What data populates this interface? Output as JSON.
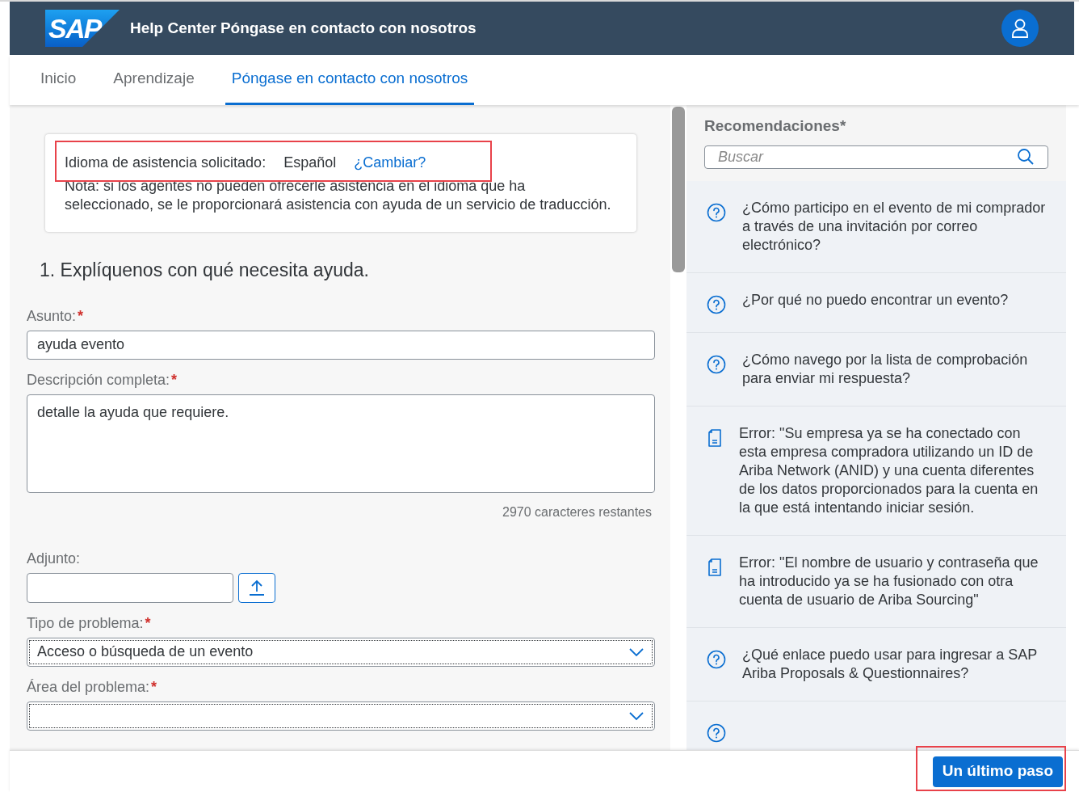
{
  "header": {
    "logo": "SAP",
    "title": "Help Center Póngase en contacto con nosotros"
  },
  "tabs": [
    {
      "label": "Inicio",
      "selected": false
    },
    {
      "label": "Aprendizaje",
      "selected": false
    },
    {
      "label": "Póngase en contacto con nosotros",
      "selected": true
    }
  ],
  "language_notice": {
    "label": "Idioma de asistencia solicitado:",
    "value": "Español",
    "link": "¿Cambiar?",
    "highlighted": true,
    "note": "Nota: si los agentes no pueden ofrecerle asistencia en el idioma que ha seleccionado, se le proporcionará asistencia con ayuda de un servicio de traducción."
  },
  "section_title": "1. Explíquenos con qué necesita ayuda.",
  "form": [
    {
      "kind": "text",
      "label": "Asunto:",
      "required_mark": "*",
      "value": "ayuda evento"
    },
    {
      "kind": "textarea",
      "label": "Descripción completa:",
      "required_mark": "*",
      "value": "detalle la ayuda que requiere.",
      "counter": "2970 caracteres restantes"
    },
    {
      "kind": "file",
      "label": "Adjunto:"
    },
    {
      "kind": "select",
      "label": "Tipo de problema:",
      "required_mark": "*",
      "value": "Acceso o búsqueda de un evento"
    },
    {
      "kind": "select",
      "label": "Área del problema:",
      "required_mark": "*"
    }
  ],
  "recommendations": {
    "title": "Recomendaciones*",
    "search_placeholder": "Buscar",
    "items": [
      {
        "kind": "question",
        "text": "¿Cómo participo en el evento de mi comprador a través de una invitación por correo electrónico?"
      },
      {
        "kind": "question",
        "text": "¿Por qué no puedo encontrar un evento?"
      },
      {
        "kind": "question",
        "text": "¿Cómo navego por la lista de comprobación para enviar mi respuesta?"
      },
      {
        "kind": "document",
        "text": "Error: \"Su empresa ya se ha conectado con esta empresa compradora utilizando un ID de Ariba Network (ANID) y una cuenta diferentes de los datos proporcionados para la cuenta en la que está intentando iniciar sesión."
      },
      {
        "kind": "document",
        "text": "Error: \"El nombre de usuario y contraseña que ha introducido ya se ha fusionado con otra cuenta de usuario de Ariba Sourcing\""
      },
      {
        "kind": "question",
        "text": "¿Qué enlace puedo usar para ingresar a SAP Ariba Proposals & Questionnaires?"
      },
      {
        "kind": "question"
      }
    ]
  },
  "footer": {
    "button": "Un último paso",
    "highlighted": true
  }
}
